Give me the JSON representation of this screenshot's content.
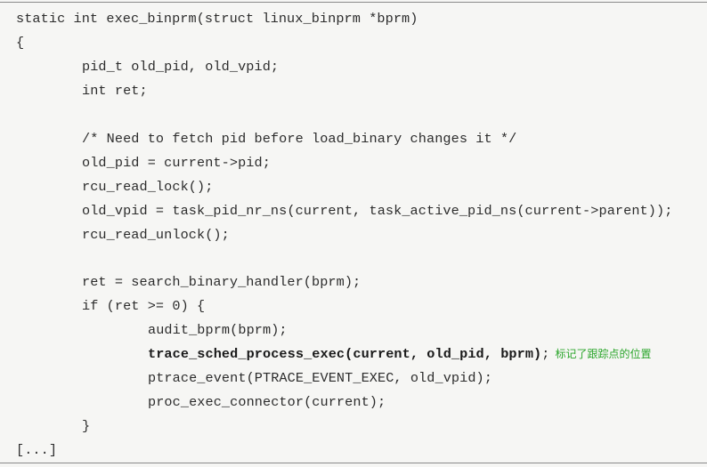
{
  "code_lines": [
    {
      "indent": 0,
      "text": "static int exec_binprm(struct linux_binprm *bprm)"
    },
    {
      "indent": 0,
      "text": "{"
    },
    {
      "indent": 1,
      "text": "pid_t old_pid, old_vpid;"
    },
    {
      "indent": 1,
      "text": "int ret;"
    },
    {
      "indent": 0,
      "text": ""
    },
    {
      "indent": 1,
      "text": "/* Need to fetch pid before load_binary changes it */"
    },
    {
      "indent": 1,
      "text": "old_pid = current->pid;"
    },
    {
      "indent": 1,
      "text": "rcu_read_lock();"
    },
    {
      "indent": 1,
      "text": "old_vpid = task_pid_nr_ns(current, task_active_pid_ns(current->parent));"
    },
    {
      "indent": 1,
      "text": "rcu_read_unlock();"
    },
    {
      "indent": 0,
      "text": ""
    },
    {
      "indent": 1,
      "text": "ret = search_binary_handler(bprm);"
    },
    {
      "indent": 1,
      "text": "if (ret >= 0) {"
    },
    {
      "indent": 2,
      "text": "audit_bprm(bprm);"
    },
    {
      "indent": 2,
      "bold": "trace_sched_process_exec(current, old_pid, bprm)",
      "text": ";",
      "note": "标记了跟踪点的位置"
    },
    {
      "indent": 2,
      "text": "ptrace_event(PTRACE_EVENT_EXEC, old_vpid);"
    },
    {
      "indent": 2,
      "text": "proc_exec_connector(current);"
    },
    {
      "indent": 1,
      "text": "}"
    },
    {
      "indent": 0,
      "text": "[...]"
    }
  ],
  "annotation_color": "#2aa52a"
}
